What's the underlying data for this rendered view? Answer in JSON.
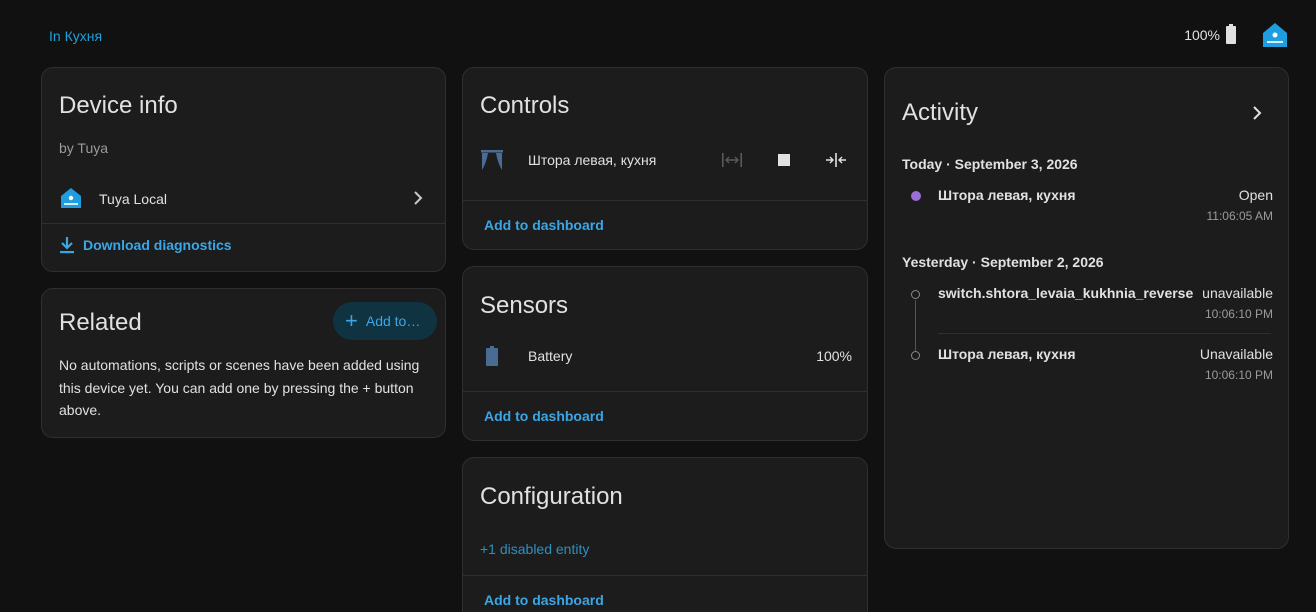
{
  "topbar": {
    "area_link": "In Кухня",
    "battery_pct": "100%"
  },
  "device_info": {
    "title": "Device info",
    "by": "by Tuya",
    "integration": "Tuya Local",
    "download": "Download diagnostics"
  },
  "related": {
    "title": "Related",
    "add_button": "Add to…",
    "text": "No automations, scripts or scenes have been added using this device yet. You can add one by pressing the + button above."
  },
  "controls": {
    "title": "Controls",
    "entity_name": "Штора левая, кухня",
    "add_dashboard": "Add to dashboard"
  },
  "sensors": {
    "title": "Sensors",
    "battery_label": "Battery",
    "battery_value": "100%",
    "add_dashboard": "Add to dashboard"
  },
  "configuration": {
    "title": "Configuration",
    "disabled": "+1 disabled entity",
    "add_dashboard": "Add to dashboard"
  },
  "activity": {
    "title": "Activity",
    "groups": [
      {
        "heading": "Today · September 3, 2026",
        "items": [
          {
            "name": "Штора левая, кухня",
            "state": "Open",
            "time": "11:06:05 AM"
          }
        ]
      },
      {
        "heading": "Yesterday · September 2, 2026",
        "items": [
          {
            "name": "switch.shtora_levaia_kukhnia_reverse",
            "state": "unavailable",
            "time": "10:06:10 PM"
          },
          {
            "name": "Штора левая, кухня",
            "state": "Unavailable",
            "time": "10:06:10 PM"
          }
        ]
      }
    ]
  },
  "colors": {
    "accent": "#3ba6e6",
    "dot_today": "#9b6fd6",
    "card_bg": "#1c1c1c",
    "page_bg": "#111111"
  }
}
